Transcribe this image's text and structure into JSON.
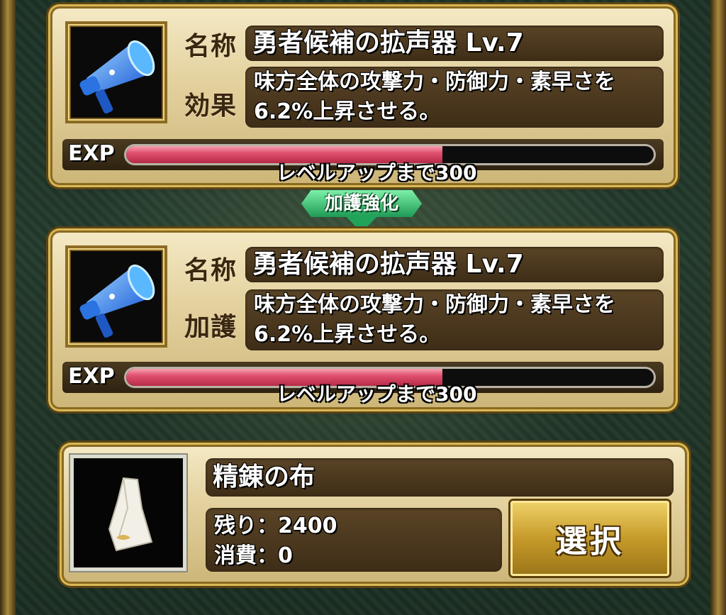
{
  "enhancement_banner": "加護強化",
  "before": {
    "name_label": "名称",
    "effect_label": "効果",
    "item_name": "勇者候補の拡声器 Lv.7",
    "effect_text_line1": "味方全体の攻撃力・防御力・素早さを",
    "effect_text_line2": "6.2%上昇させる。",
    "exp_label": "EXP",
    "exp_progress": 0.6,
    "exp_caption": "レベルアップまで300",
    "icon": "megaphone-icon"
  },
  "after": {
    "name_label": "名称",
    "effect_label": "加護",
    "item_name": "勇者候補の拡声器 Lv.7",
    "effect_text_line1": "味方全体の攻撃力・防御力・素早さを",
    "effect_text_line2": "6.2%上昇させる。",
    "exp_label": "EXP",
    "exp_progress": 0.6,
    "exp_caption": "レベルアップまで300",
    "icon": "megaphone-icon"
  },
  "material": {
    "name": "精錬の布",
    "remaining": "残り：2400",
    "consumed": "消費：0",
    "select_label": "選択",
    "icon": "cloth-icon"
  },
  "colors": {
    "exp_fill": "#e0506e",
    "banner_green": "#1e9a55",
    "gold": "#d9b855"
  }
}
